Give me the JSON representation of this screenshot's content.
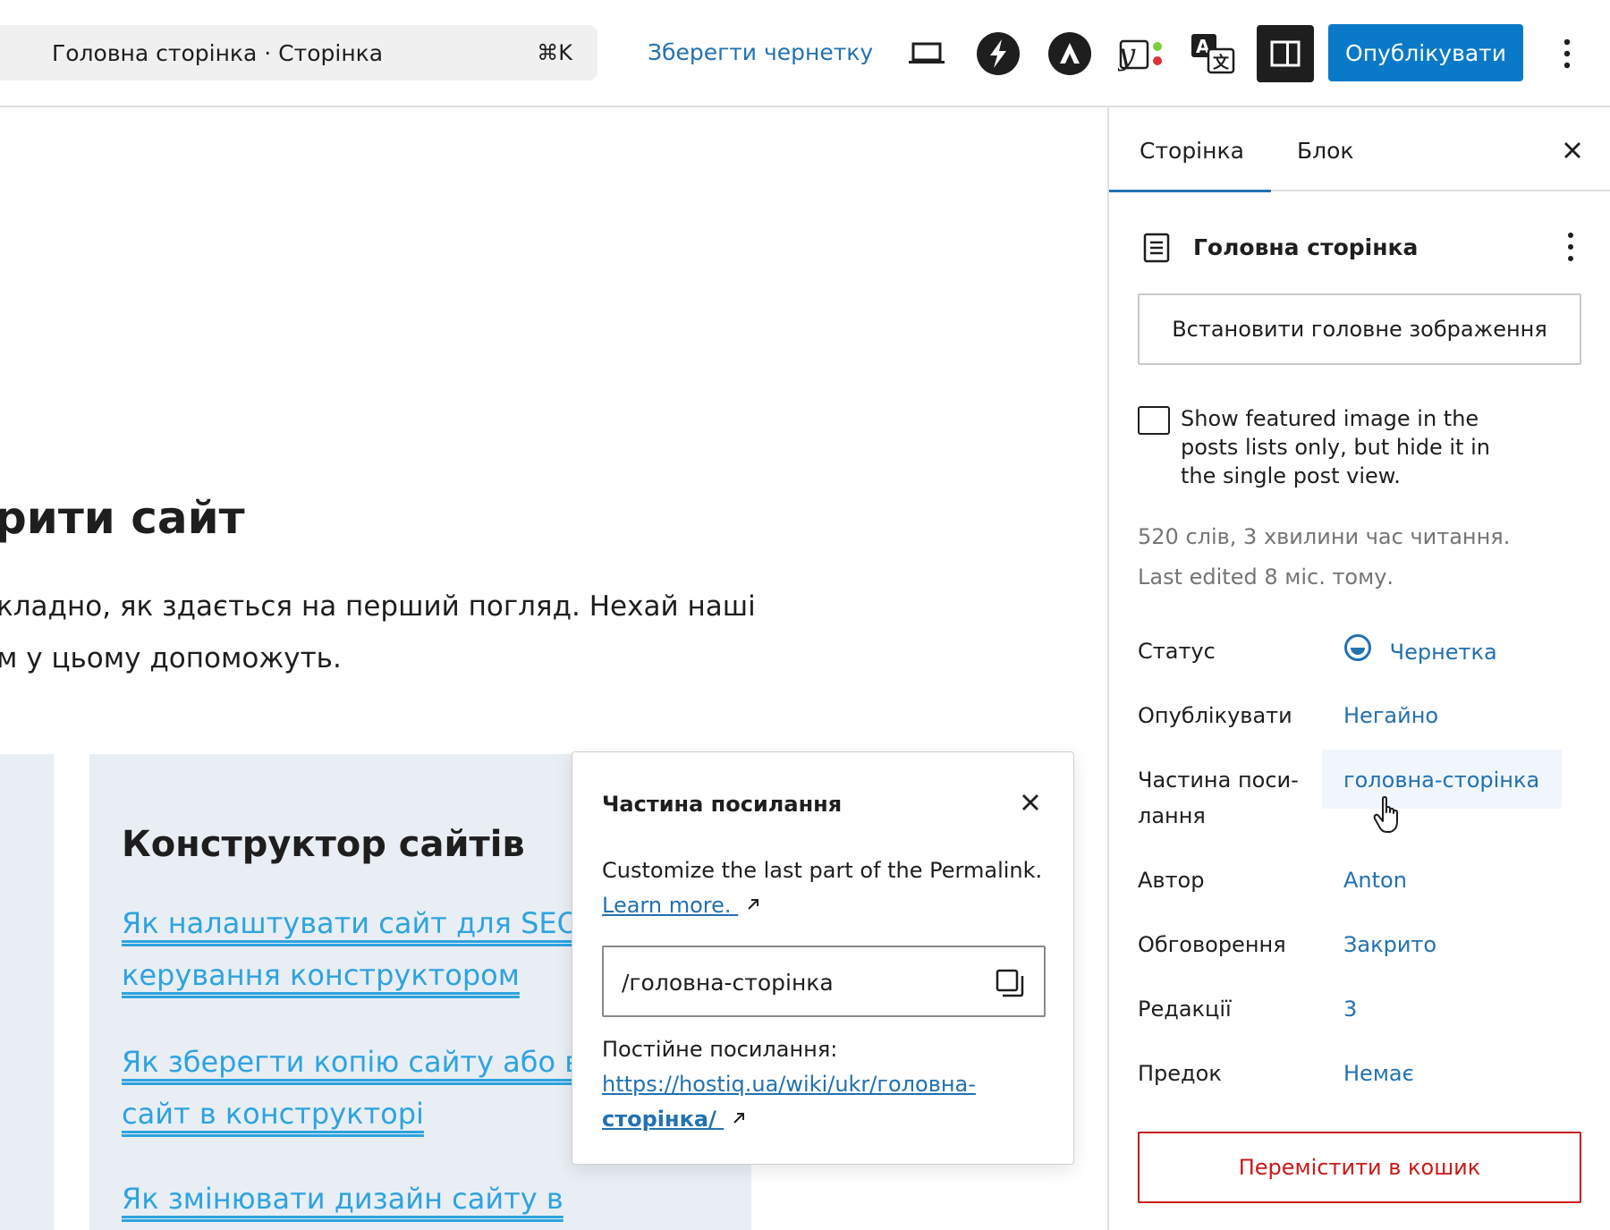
{
  "topbar": {
    "command_title": "Головна сторінка · Сторінка",
    "command_shortcut": "⌘K",
    "save_draft": "Зберегти чернетку",
    "publish": "Опублікувати",
    "icons": [
      "desktop-preview-icon",
      "speed-bolt-icon",
      "astra-icon",
      "yoast-seo-icon",
      "translate-icon",
      "sidebar-toggle-icon",
      "more-vertical-icon"
    ],
    "colors": {
      "accent": "#2271b1",
      "publish_bg": "#0a7ac8",
      "yoast_green": "#7ad03a",
      "yoast_red": "#dc3232"
    }
  },
  "canvas": {
    "heading": "рити сайт",
    "paragraph_line1": "кладно, як здається на перший погляд. Нехай наші",
    "paragraph_line2": "м у цьому допоможуть.",
    "card": {
      "title": "Конструктор сайтів",
      "links": [
        "Як налаштувати сайт для SEO",
        "керування конструктором",
        "Як зберегти копію сайту або в",
        "сайт в конструкторі",
        "Як змінювати дизайн сайту в"
      ]
    }
  },
  "popover": {
    "title": "Частина посилання",
    "description": "Customize the last part of the Permalink.",
    "learn_more": "Learn more.",
    "slug_value": "/головна-сторінка",
    "permalink_label": "Постійне посилання:",
    "permalink_url_line1": "https://hostiq.ua/wiki/ukr/головна-",
    "permalink_url_line2": "сторінка/"
  },
  "sidebar": {
    "tabs": [
      {
        "label": "Сторінка",
        "active": true
      },
      {
        "label": "Блок",
        "active": false
      }
    ],
    "document_title": "Головна сторінка",
    "featured_image_button": "Встановити головне зображення",
    "checkbox": {
      "checked": false,
      "line1": "Show featured image in the",
      "line2": "posts lists only, but hide it in",
      "line3": "the single post view."
    },
    "word_count": "520 слів, 3 хвилини час читання.",
    "last_edited": "Last edited 8 міс. тому.",
    "properties": [
      {
        "label": "Статус",
        "value": "Чернетка"
      },
      {
        "label": "Опублікувати",
        "value": "Негайно"
      },
      {
        "label": "Частина поси-",
        "label_line2": "лання",
        "value": "головна-сторінка"
      },
      {
        "label": "Автор",
        "value": "Anton"
      },
      {
        "label": "Обговорення",
        "value": "Закрито"
      },
      {
        "label": "Редакції",
        "value": "3"
      },
      {
        "label": "Предок",
        "value": "Немає"
      }
    ],
    "trash_button": "Перемістити в кошик",
    "colors": {
      "danger": "#cc1818",
      "link": "#2271b1"
    }
  }
}
